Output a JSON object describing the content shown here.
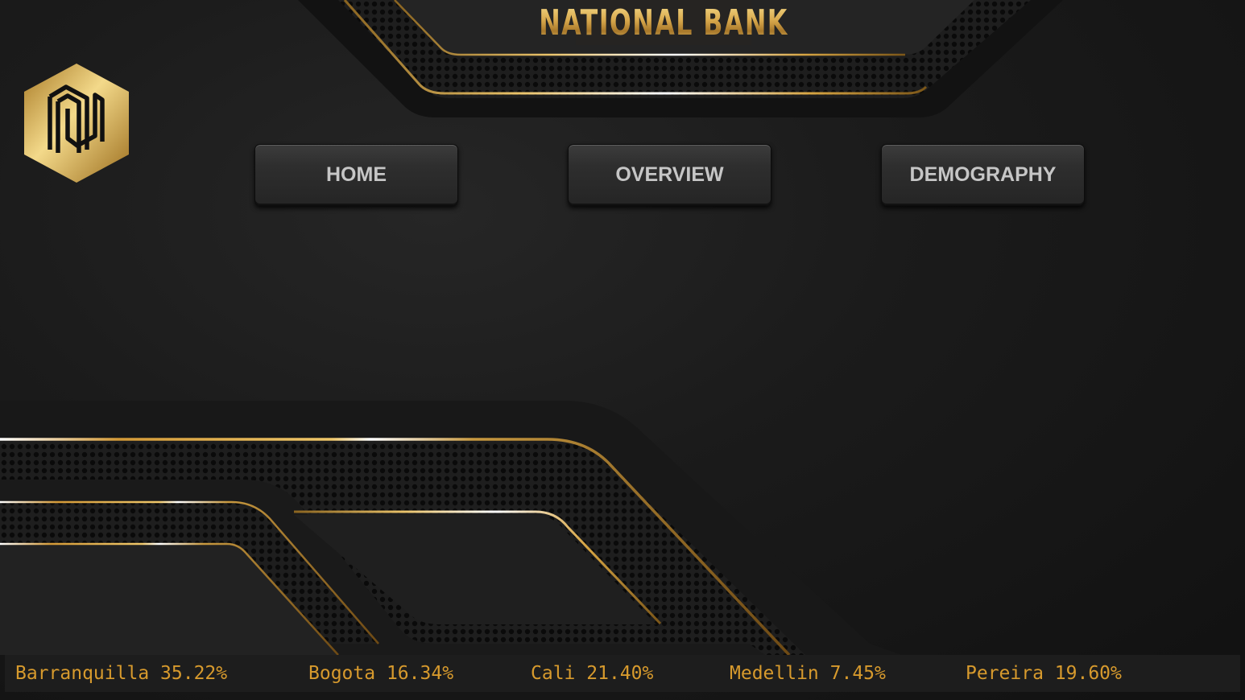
{
  "header": {
    "title": "NATIONAL BANK"
  },
  "logo": {
    "icon": "bank-hexagon-logo-icon"
  },
  "nav": {
    "home_label": "HOME",
    "overview_label": "OVERVIEW",
    "demography_label": "DEMOGRAPHY"
  },
  "ticker": [
    {
      "city": "Barranquilla",
      "value": "35.22%"
    },
    {
      "city": "Bogota",
      "value": "16.34%"
    },
    {
      "city": "Cali",
      "value": "21.40%"
    },
    {
      "city": "Medellin",
      "value": "7.45%"
    },
    {
      "city": "Pereira",
      "value": "19.60%"
    }
  ],
  "colors": {
    "gold": "#d79a2d",
    "background": "#151515",
    "button_text": "#c6c6c6"
  }
}
